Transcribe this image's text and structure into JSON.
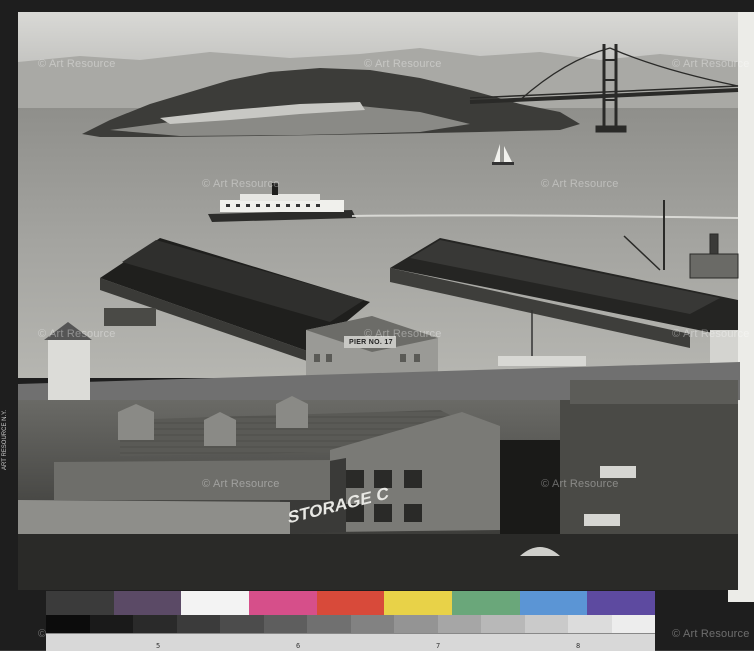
{
  "watermark": "Art Resource",
  "pier_sign": "PIER NO. 17",
  "building_sign": "STORAGE C",
  "edge_label": "ART RESOURCE N.Y.",
  "color_target": {
    "swatches": [
      "#3b3b3b",
      "#5b4a66",
      "#f3f3f3",
      "#d64f8a",
      "#d84a3a",
      "#e8d248",
      "#6aa77a",
      "#5b95d5",
      "#5d4aa0"
    ],
    "grays": [
      "#0c0c0c",
      "#1a1a1a",
      "#2a2a2a",
      "#3b3b3b",
      "#4c4c4c",
      "#5e5e5e",
      "#707070",
      "#828282",
      "#949494",
      "#a6a6a6",
      "#b8b8b8",
      "#cacaca",
      "#dcdcdc",
      "#ededed"
    ],
    "ruler_marks": [
      "5",
      "6",
      "7",
      "8"
    ]
  }
}
